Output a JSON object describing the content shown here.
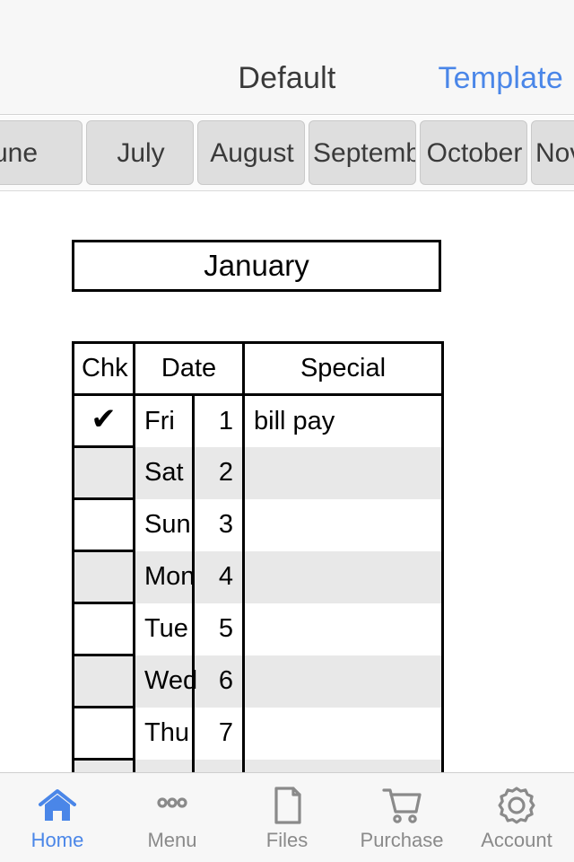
{
  "navbar": {
    "title": "Default",
    "right_action": "Template"
  },
  "month_tabs": {
    "items": [
      {
        "label": "June",
        "clipped": true,
        "selected": false
      },
      {
        "label": "July",
        "clipped": false,
        "selected": false
      },
      {
        "label": "August",
        "clipped": false,
        "selected": false
      },
      {
        "label": "September",
        "clipped": true,
        "selected": false
      },
      {
        "label": "October",
        "clipped": false,
        "selected": false
      },
      {
        "label": "November",
        "clipped": true,
        "selected": false
      }
    ]
  },
  "sheet": {
    "month_title": "January",
    "table": {
      "headers": {
        "chk": "Chk",
        "date": "Date",
        "special": "Special"
      },
      "rows": [
        {
          "checked": true,
          "check_glyph": "✔",
          "dow": "Fri",
          "day": "1",
          "special": "bill pay",
          "shaded": false
        },
        {
          "checked": false,
          "check_glyph": "",
          "dow": "Sat",
          "day": "2",
          "special": "",
          "shaded": true
        },
        {
          "checked": false,
          "check_glyph": "",
          "dow": "Sun",
          "day": "3",
          "special": "",
          "shaded": false
        },
        {
          "checked": false,
          "check_glyph": "",
          "dow": "Mon",
          "day": "4",
          "special": "",
          "shaded": true
        },
        {
          "checked": false,
          "check_glyph": "",
          "dow": "Tue",
          "day": "5",
          "special": "",
          "shaded": false
        },
        {
          "checked": false,
          "check_glyph": "",
          "dow": "Wed",
          "day": "6",
          "special": "",
          "shaded": true
        },
        {
          "checked": false,
          "check_glyph": "",
          "dow": "Thu",
          "day": "7",
          "special": "",
          "shaded": false
        },
        {
          "checked": false,
          "check_glyph": "",
          "dow": "",
          "day": "",
          "special": "",
          "shaded": true
        }
      ]
    }
  },
  "tabbar": {
    "items": [
      {
        "label": "Home",
        "icon": "home-icon",
        "active": true
      },
      {
        "label": "Menu",
        "icon": "ellipsis-icon",
        "active": false
      },
      {
        "label": "Files",
        "icon": "document-icon",
        "active": false
      },
      {
        "label": "Purchase",
        "icon": "cart-icon",
        "active": false
      },
      {
        "label": "Account",
        "icon": "gear-icon",
        "active": false
      }
    ]
  },
  "colors": {
    "accent": "#4a86e8",
    "inactive": "#8a8a8a",
    "chrome": "#f7f7f7",
    "tab_fill": "#dedede",
    "row_shade": "#e8e8e8",
    "grid": "#000000"
  }
}
